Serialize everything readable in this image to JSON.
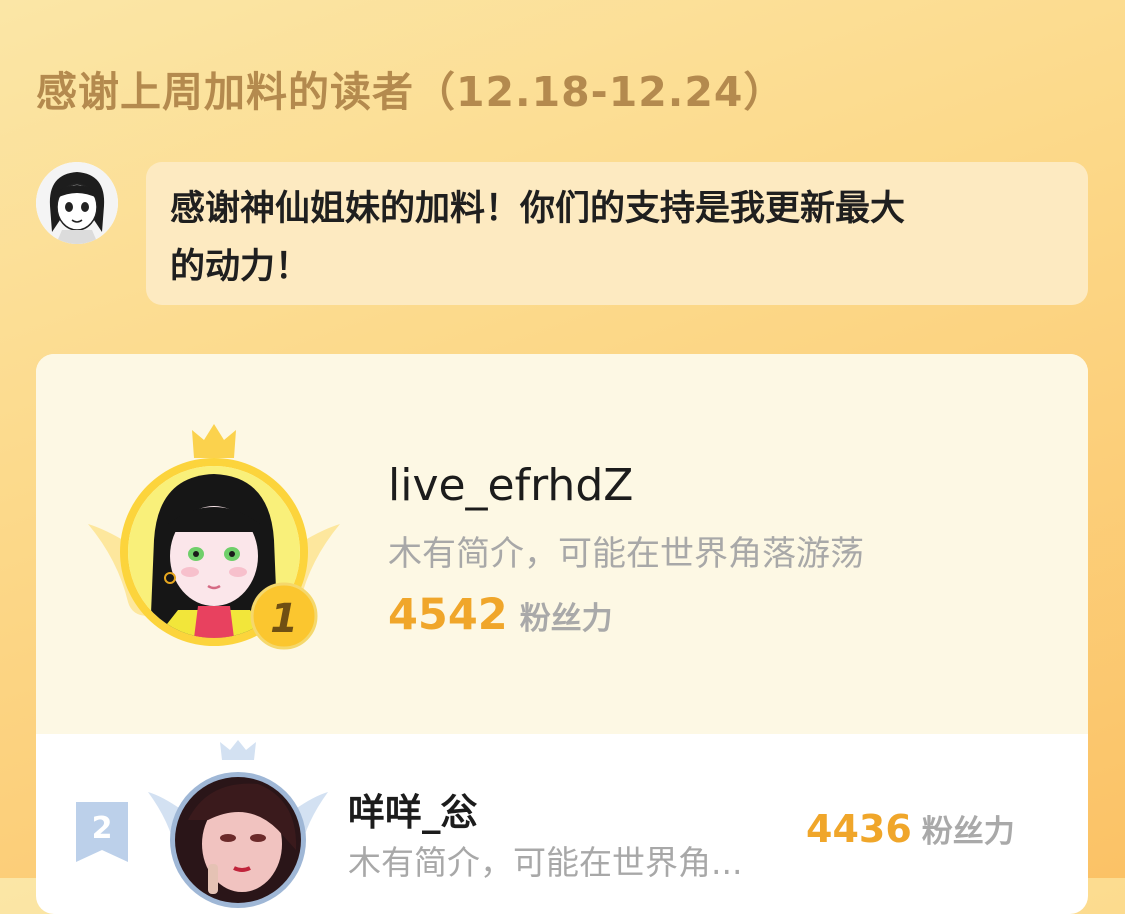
{
  "header": {
    "title": "感谢上周加料的读者（12.18-12.24）"
  },
  "author_message": {
    "line1": "感谢神仙姐妹的加料！你们的支持是我更新最大",
    "line2": "的动力！"
  },
  "ranking": [
    {
      "rank": "1",
      "name": "live_efrhdZ",
      "intro": "木有简介，可能在世界角落游荡",
      "fan_power": "4542",
      "unit": "粉丝力"
    },
    {
      "rank": "2",
      "name": "咩咩_忩",
      "intro": "木有简介，可能在世界角...",
      "fan_power": "4436",
      "unit": "粉丝力"
    }
  ],
  "colors": {
    "accent": "#f0a62a",
    "gold": "#fbc62f",
    "silver": "#c3d6ee",
    "title": "#b48a4e"
  }
}
